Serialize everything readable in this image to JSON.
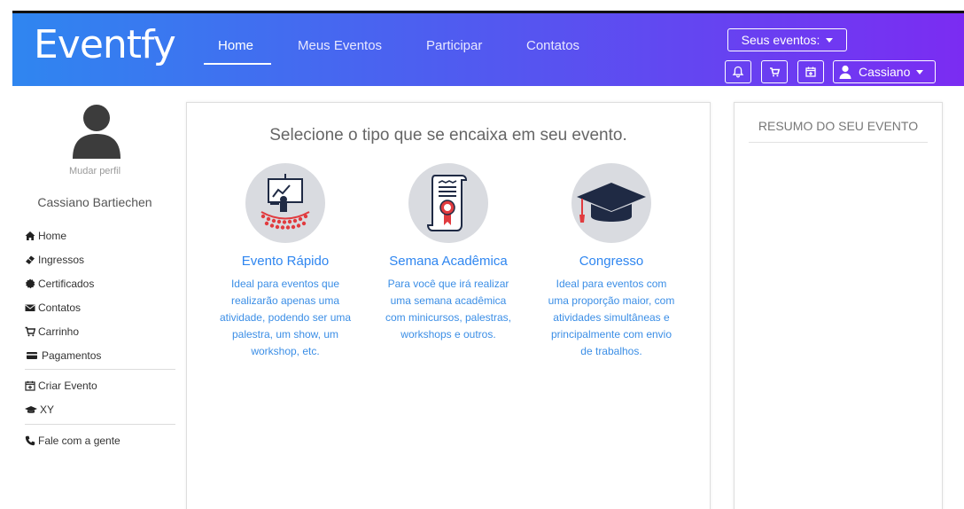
{
  "brand": "Eventfy",
  "nav": {
    "home": "Home",
    "my_events": "Meus Eventos",
    "participate": "Participar",
    "contacts": "Contatos"
  },
  "header_right": {
    "events_dropdown": "Seus eventos:",
    "user_dropdown": "Cassiano"
  },
  "sidebar": {
    "change_profile": "Mudar perfil",
    "user_name": "Cassiano Bartiechen",
    "items": [
      {
        "label": "Home",
        "icon": "home-icon"
      },
      {
        "label": "Ingressos",
        "icon": "ticket-icon"
      },
      {
        "label": "Certificados",
        "icon": "certificate-icon"
      },
      {
        "label": "Contatos",
        "icon": "envelope-icon"
      },
      {
        "label": "Carrinho",
        "icon": "cart-icon"
      },
      {
        "label": "Pagamentos",
        "icon": "credit-card-icon"
      },
      {
        "label": "Criar Evento",
        "icon": "calendar-plus-icon"
      },
      {
        "label": "XY",
        "icon": "graduation-cap-icon"
      },
      {
        "label": "Fale com a gente",
        "icon": "phone-icon"
      }
    ]
  },
  "main": {
    "title": "Selecione o tipo que se encaixa em seu evento.",
    "cards": [
      {
        "title": "Evento Rápido",
        "description": "Ideal para eventos que realizarão apenas uma atividade, podendo ser uma palestra, um show, um workshop, etc."
      },
      {
        "title": "Semana Acadêmica",
        "description": "Para você que irá realizar uma semana acadêmica com minicursos, palestras, workshops e outros."
      },
      {
        "title": "Congresso",
        "description": "Ideal para eventos com uma proporção maior, com atividades simultâneas e principalmente com envio de trabalhos."
      }
    ]
  },
  "summary": {
    "title": "RESUMO DO SEU EVENTO"
  },
  "colors": {
    "gradient_start": "#2f86f0",
    "gradient_end": "#7b2cf2",
    "link_blue": "#2f86f0"
  }
}
